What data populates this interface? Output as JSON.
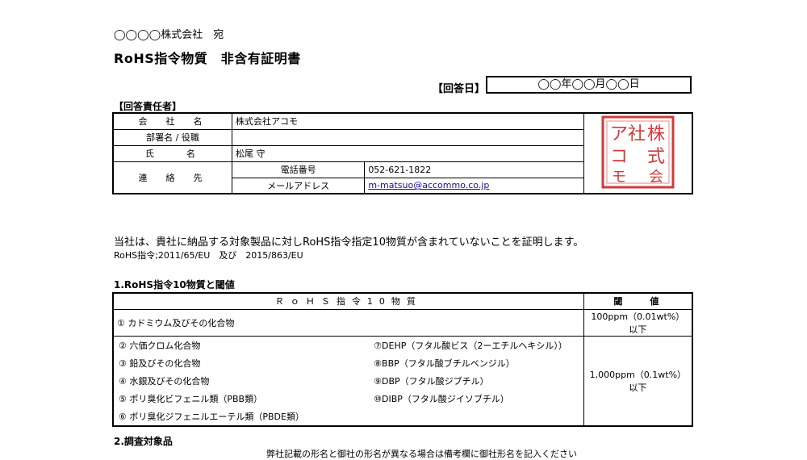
{
  "header": {
    "addressee": "◯◯◯◯株式会社　宛",
    "title": "RoHS指令物質　非含有証明書",
    "date_label": "【回答日】",
    "date_value": "◯◯年◯◯月◯◯日"
  },
  "responder": {
    "section_title": "【回答責任者】",
    "company_label": "会　社　名",
    "company_value": "株式会社アコモ",
    "dept_label": "部署名 / 役職",
    "dept_value": "",
    "name_label": "氏　　名",
    "name_value": "松尾 守",
    "contact_label": "連　絡　先",
    "phone_label": "電話番号",
    "phone_value": "052-621-1822",
    "email_label": "メールアドレス",
    "email_value": "m-matsuo@accommo.co.jp",
    "stamp_text": "株式会社アコモ"
  },
  "statement": {
    "main": "当社は、貴社に納品する対象製品に対しRoHS指令指定10物質が含まれていないことを証明します。",
    "directive": "RoHS指令;2011/65/EU　及び　2015/863/EU"
  },
  "section1": {
    "title": "1.RoHS指令10物質と閾値",
    "header_substances": "ＲｏＨＳ指令10物質",
    "header_threshold": "閾　　値",
    "row1_substance": "① カドミウム及びその化合物",
    "row1_threshold": "100ppm（0.01wt%）以下",
    "left_items": [
      "② 六価クロム化合物",
      "③ 鉛及びその化合物",
      "④ 水銀及びその化合物",
      "⑤ ポリ臭化ビフェニル類（PBB類）",
      "⑥ ポリ臭化ジフェニルエーテル類（PBDE類）"
    ],
    "right_items": [
      "⑦DEHP（フタル酸ビス（2ーエチルヘキシル））",
      "⑧BBP（フタル酸ブチルベンジル）",
      "⑨DBP（フタル酸ジブチル）",
      "⑩DIBP（フタル酸ジイソブチル）"
    ],
    "group_threshold": "1,000ppm（0.1wt%）以下"
  },
  "section2": {
    "title": "2.調査対象品",
    "note": "弊社記載の形名と御社の形名が異なる場合は備考欄に御社形名を記入ください"
  },
  "colors": {
    "stamp": "#d23a3a"
  }
}
